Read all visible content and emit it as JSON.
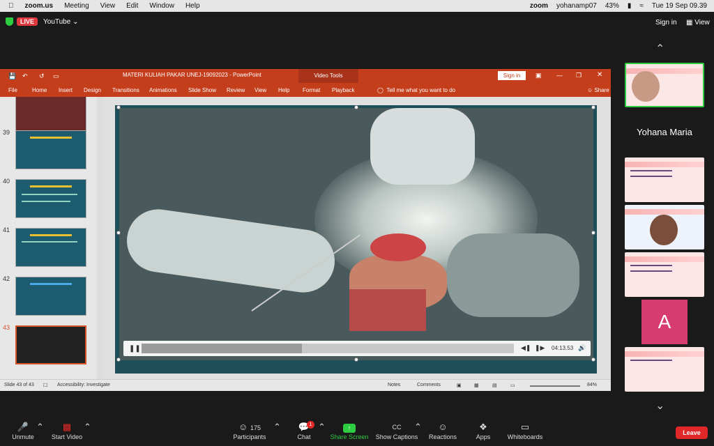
{
  "menubar": {
    "app": "zoom.us",
    "items": [
      "Meeting",
      "View",
      "Edit",
      "Window",
      "Help"
    ],
    "zoom_brand": "zoom",
    "user": "yohanamp07",
    "battery": "43%",
    "datetime": "Tue 19 Sep  09.39"
  },
  "zoomtop": {
    "live": "LIVE",
    "platform": "YouTube",
    "signin": "Sign in",
    "view": "View"
  },
  "ppt": {
    "doc_title": "MATERI KULIAH PAKAR UNEJ-19092023  -  PowerPoint",
    "video_tools": "Video Tools",
    "signin": "Sign in",
    "tabs": [
      "File",
      "Home",
      "Insert",
      "Design",
      "Transitions",
      "Animations",
      "Slide Show",
      "Review",
      "View",
      "Help",
      "Format",
      "Playback"
    ],
    "tell_me": "Tell me what you want to do",
    "share": "Share",
    "slide_numbers": [
      "39",
      "40",
      "41",
      "42",
      "43"
    ],
    "video": {
      "time": "04:13.53",
      "progress": 0.43
    },
    "status": {
      "slide_of": "Slide 43 of 43",
      "accessibility": "Accessibility: Investigate",
      "notes": "Notes",
      "comments": "Comments",
      "zoom": "84%"
    }
  },
  "gallery": {
    "name_tile": "Yohana Maria",
    "avatar_letter": "A"
  },
  "toolbar": {
    "unmute": "Unmute",
    "start_video": "Start Video",
    "participants": "Participants",
    "participants_count": "175",
    "chat": "Chat",
    "chat_badge": "1",
    "share_screen": "Share Screen",
    "captions": "Show Captions",
    "captions_icon": "CC",
    "reactions": "Reactions",
    "apps": "Apps",
    "whiteboards": "Whiteboards",
    "leave": "Leave"
  },
  "colors": {
    "ppt_accent": "#c43e1c",
    "zoom_green": "#2ecc40",
    "leave_red": "#e02828"
  }
}
